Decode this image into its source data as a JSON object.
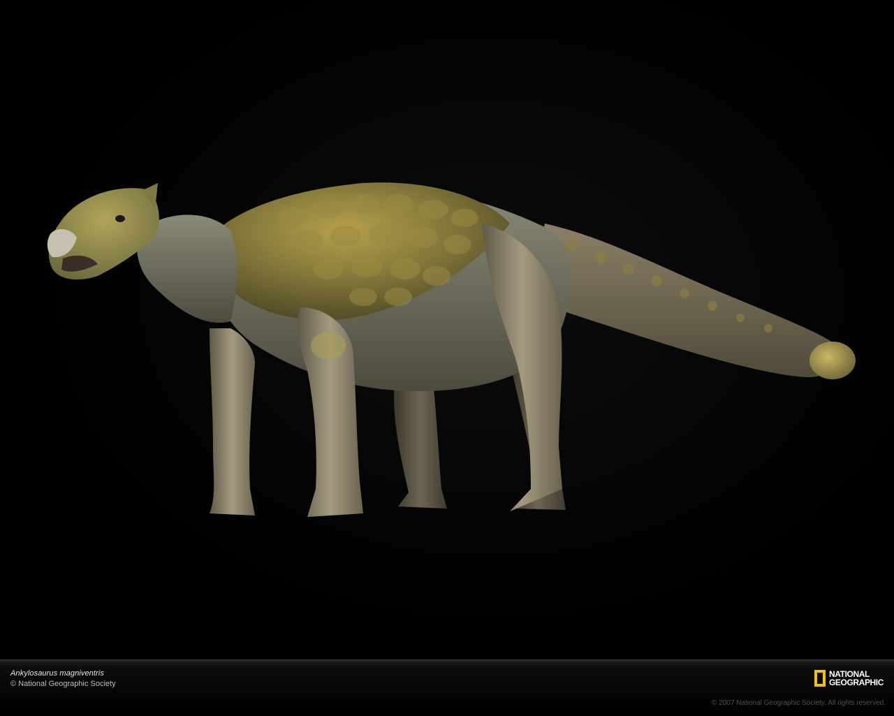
{
  "scene": {
    "subject_icon": "ankylosaurus-illustration",
    "background_color": "#000000"
  },
  "caption": {
    "title": "Ankylosaurus magniventris",
    "credit": "© National Geographic Society"
  },
  "logo": {
    "line1": "NATIONAL",
    "line2": "GEOGRAPHIC",
    "frame_color": "#f2c400"
  },
  "copyright": "© 2007 National Geographic Society. All rights reserved."
}
